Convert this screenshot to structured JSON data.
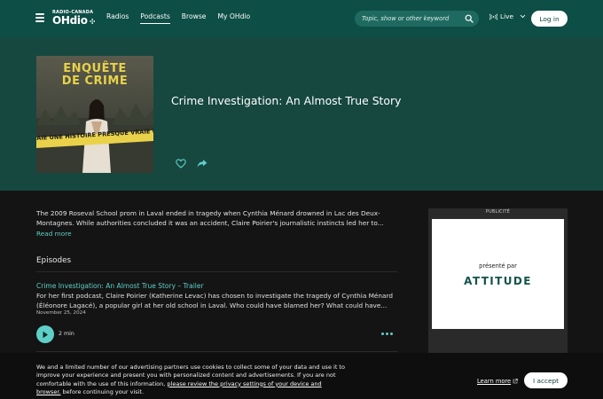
{
  "header": {
    "brand_top": "RADIO-CANADA",
    "brand_main": "OHdio",
    "nav": [
      {
        "label": "Radios",
        "active": false
      },
      {
        "label": "Podcasts",
        "active": true
      },
      {
        "label": "Browse",
        "active": false
      },
      {
        "label": "My OHdio",
        "active": false
      }
    ],
    "search_placeholder": "Topic, show or other keyword",
    "live_label": "Live",
    "login_label": "Log in"
  },
  "podcast": {
    "cover_title_line1": "ENQUÊTE",
    "cover_title_line2": "DE CRIME",
    "cover_tape_text": "AIE  UNE HISTOIRE PRESQUE VRAIE  UNE",
    "title": "Crime Investigation: An Almost True Story",
    "description": "The 2009 Roseval School prom in Laval ended in tragedy when Cynthia Ménard drowned in Lac des Deux-Montagnes. While authorities concluded it was an accident, Claire Poirier's journalistic instincts led her to...",
    "read_more": "Read more"
  },
  "episodes": {
    "heading": "Episodes",
    "items": [
      {
        "title": "Crime Investigation: An Almost True Story – Trailer",
        "description": "For her first podcast, Claire Poirier (Katherine Levac) has chosen to investigate the tragedy of Cynthia Ménard (Éléonore Lagacé), a popular girl at her old school in Laval. Who could have blamed her? What could have...",
        "date": "November 25, 2024",
        "duration": "2 min"
      }
    ]
  },
  "ad": {
    "label": "PUBLICITÉ",
    "presented_by": "présenté par",
    "brand": "ATTITUDE"
  },
  "cookie": {
    "text_before": "We and a limited number of our advertising partners use cookies to collect some of your data and use it to improve your experience and present you with personalized content and advertisements. If you are not comfortable with the use of this information, ",
    "link_text": "please review the privacy settings of your device and browser.",
    "text_after": " before continuing your visit.",
    "learn_more": "Learn more",
    "accept": "I accept"
  },
  "colors": {
    "header_bg": "#0d4e46",
    "hero_bg": "#164840",
    "accent": "#5ed0c8",
    "page_bg": "#141414"
  }
}
